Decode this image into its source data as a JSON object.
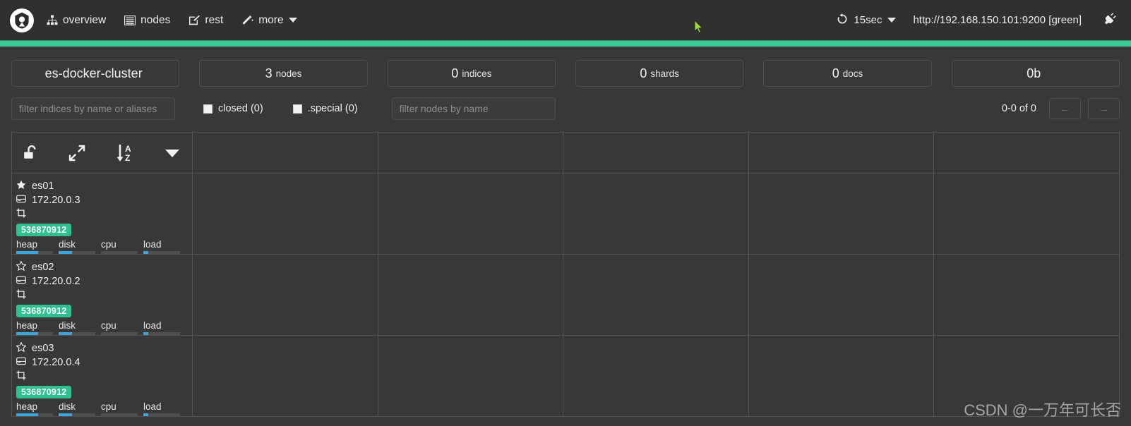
{
  "navbar": {
    "brand_icon": "cerebro-logo-icon",
    "items": [
      {
        "label": "overview",
        "icon": "sitemap-icon"
      },
      {
        "label": "nodes",
        "icon": "list-icon"
      },
      {
        "label": "rest",
        "icon": "edit-square-icon"
      },
      {
        "label": "more",
        "icon": "magic-wand-icon",
        "has_caret": true
      }
    ],
    "refresh": {
      "label": "15sec",
      "icon": "refresh-icon",
      "has_caret": true
    },
    "cluster_url": "http://192.168.150.101:9200 [green]",
    "disconnect_icon": "plug-icon",
    "accent_color": "#3cc894",
    "bg_color": "#303030"
  },
  "cards": [
    {
      "name": "cluster-name",
      "num": "es-docker-cluster",
      "unit": ""
    },
    {
      "name": "nodes",
      "num": "3",
      "unit": "nodes"
    },
    {
      "name": "indices",
      "num": "0",
      "unit": "indices"
    },
    {
      "name": "shards",
      "num": "0",
      "unit": "shards"
    },
    {
      "name": "docs",
      "num": "0",
      "unit": "docs"
    },
    {
      "name": "size",
      "num": "0b",
      "unit": ""
    }
  ],
  "filters": {
    "indices_placeholder": "filter indices by name or aliases",
    "indices_value": "",
    "closed_label": "closed (0)",
    "closed_checked": false,
    "special_label": ".special (0)",
    "special_checked": false,
    "nodes_placeholder": "filter nodes by name",
    "nodes_value": "",
    "pager_label": "0-0 of 0",
    "prev_label": "←",
    "next_label": "→"
  },
  "table": {
    "header_icons": [
      "unlock-icon",
      "expand-arrows-icon",
      "sort-alpha-down-icon",
      "caret-down-icon"
    ],
    "empty_columns": 5,
    "nodes": [
      {
        "name": "es01",
        "master": true,
        "master_icon": "star-filled-icon",
        "ip": "172.20.0.3",
        "ip_icon": "hdd-icon",
        "role_icon": "crop-icon",
        "heap_badge": "536870912",
        "metrics": [
          {
            "label": "heap",
            "percent": 60
          },
          {
            "label": "disk",
            "percent": 36
          },
          {
            "label": "cpu",
            "percent": 0
          },
          {
            "label": "load",
            "percent": 14
          }
        ]
      },
      {
        "name": "es02",
        "master": false,
        "master_icon": "star-outline-icon",
        "ip": "172.20.0.2",
        "ip_icon": "hdd-icon",
        "role_icon": "crop-icon",
        "heap_badge": "536870912",
        "metrics": [
          {
            "label": "heap",
            "percent": 60
          },
          {
            "label": "disk",
            "percent": 36
          },
          {
            "label": "cpu",
            "percent": 0
          },
          {
            "label": "load",
            "percent": 14
          }
        ]
      },
      {
        "name": "es03",
        "master": false,
        "master_icon": "star-outline-icon",
        "ip": "172.20.0.4",
        "ip_icon": "hdd-icon",
        "role_icon": "crop-icon",
        "heap_badge": "536870912",
        "metrics": [
          {
            "label": "heap",
            "percent": 60
          },
          {
            "label": "disk",
            "percent": 36
          },
          {
            "label": "cpu",
            "percent": 0
          },
          {
            "label": "load",
            "percent": 14
          }
        ]
      }
    ]
  },
  "watermark": "CSDN @一万年可长否"
}
